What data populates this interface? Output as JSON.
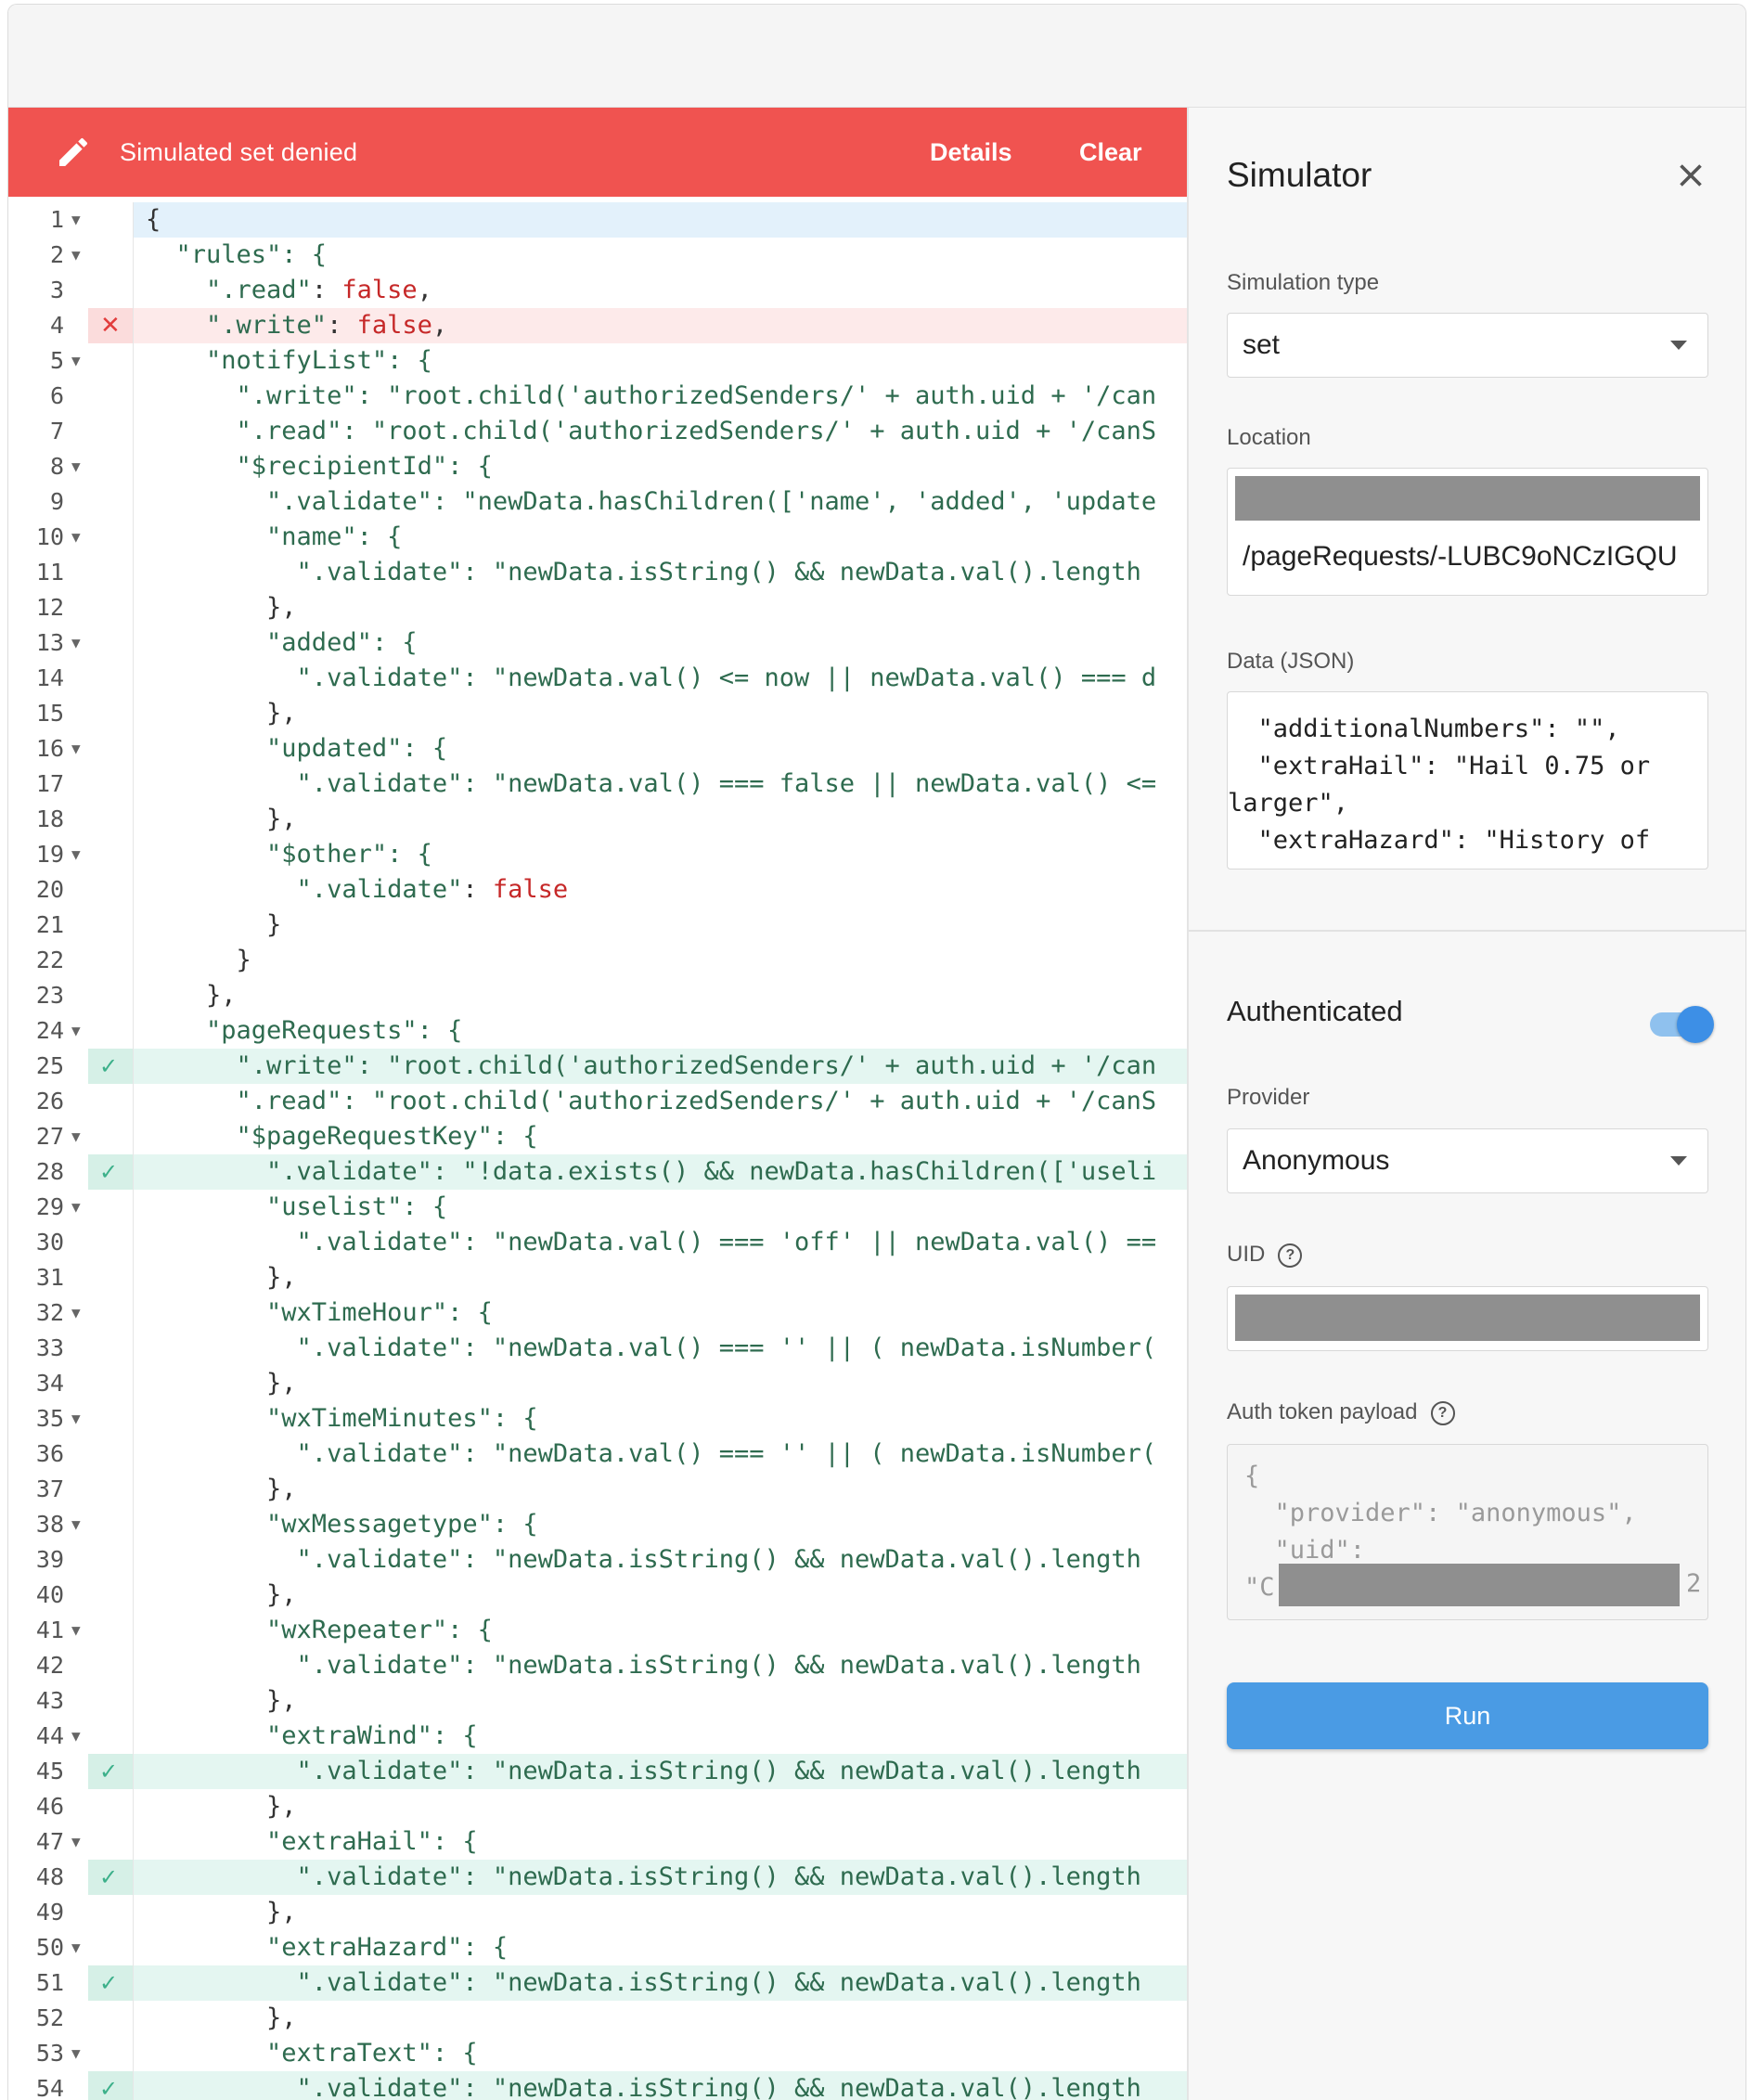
{
  "banner": {
    "message": "Simulated set denied",
    "details_label": "Details",
    "clear_label": "Clear",
    "color": "#f05350"
  },
  "editor": {
    "lines": [
      {
        "n": "1",
        "fold": true,
        "mark": "",
        "text": "{"
      },
      {
        "n": "2",
        "fold": true,
        "mark": "",
        "text": "  \"rules\": {"
      },
      {
        "n": "3",
        "fold": false,
        "mark": "",
        "text": "    \".read\": false,"
      },
      {
        "n": "4",
        "fold": false,
        "mark": "err",
        "text": "    \".write\": false,"
      },
      {
        "n": "5",
        "fold": true,
        "mark": "",
        "text": "    \"notifyList\": {"
      },
      {
        "n": "6",
        "fold": false,
        "mark": "",
        "text": "      \".write\": \"root.child('authorizedSenders/' + auth.uid + '/can"
      },
      {
        "n": "7",
        "fold": false,
        "mark": "",
        "text": "      \".read\": \"root.child('authorizedSenders/' + auth.uid + '/canS"
      },
      {
        "n": "8",
        "fold": true,
        "mark": "",
        "text": "      \"$recipientId\": {"
      },
      {
        "n": "9",
        "fold": false,
        "mark": "",
        "text": "        \".validate\": \"newData.hasChildren(['name', 'added', 'update"
      },
      {
        "n": "10",
        "fold": true,
        "mark": "",
        "text": "        \"name\": {"
      },
      {
        "n": "11",
        "fold": false,
        "mark": "",
        "text": "          \".validate\": \"newData.isString() && newData.val().length"
      },
      {
        "n": "12",
        "fold": false,
        "mark": "",
        "text": "        },"
      },
      {
        "n": "13",
        "fold": true,
        "mark": "",
        "text": "        \"added\": {"
      },
      {
        "n": "14",
        "fold": false,
        "mark": "",
        "text": "          \".validate\": \"newData.val() <= now || newData.val() === d"
      },
      {
        "n": "15",
        "fold": false,
        "mark": "",
        "text": "        },"
      },
      {
        "n": "16",
        "fold": true,
        "mark": "",
        "text": "        \"updated\": {"
      },
      {
        "n": "17",
        "fold": false,
        "mark": "",
        "text": "          \".validate\": \"newData.val() === false || newData.val() <="
      },
      {
        "n": "18",
        "fold": false,
        "mark": "",
        "text": "        },"
      },
      {
        "n": "19",
        "fold": true,
        "mark": "",
        "text": "        \"$other\": {"
      },
      {
        "n": "20",
        "fold": false,
        "mark": "",
        "text": "          \".validate\": false"
      },
      {
        "n": "21",
        "fold": false,
        "mark": "",
        "text": "        }"
      },
      {
        "n": "22",
        "fold": false,
        "mark": "",
        "text": "      }"
      },
      {
        "n": "23",
        "fold": false,
        "mark": "",
        "text": "    },"
      },
      {
        "n": "24",
        "fold": true,
        "mark": "",
        "text": "    \"pageRequests\": {"
      },
      {
        "n": "25",
        "fold": false,
        "mark": "ok",
        "text": "      \".write\": \"root.child('authorizedSenders/' + auth.uid + '/can"
      },
      {
        "n": "26",
        "fold": false,
        "mark": "",
        "text": "      \".read\": \"root.child('authorizedSenders/' + auth.uid + '/canS"
      },
      {
        "n": "27",
        "fold": true,
        "mark": "",
        "text": "      \"$pageRequestKey\": {"
      },
      {
        "n": "28",
        "fold": false,
        "mark": "ok",
        "text": "        \".validate\": \"!data.exists() && newData.hasChildren(['useli"
      },
      {
        "n": "29",
        "fold": true,
        "mark": "",
        "text": "        \"uselist\": {"
      },
      {
        "n": "30",
        "fold": false,
        "mark": "",
        "text": "          \".validate\": \"newData.val() === 'off' || newData.val() =="
      },
      {
        "n": "31",
        "fold": false,
        "mark": "",
        "text": "        },"
      },
      {
        "n": "32",
        "fold": true,
        "mark": "",
        "text": "        \"wxTimeHour\": {"
      },
      {
        "n": "33",
        "fold": false,
        "mark": "",
        "text": "          \".validate\": \"newData.val() === '' || ( newData.isNumber("
      },
      {
        "n": "34",
        "fold": false,
        "mark": "",
        "text": "        },"
      },
      {
        "n": "35",
        "fold": true,
        "mark": "",
        "text": "        \"wxTimeMinutes\": {"
      },
      {
        "n": "36",
        "fold": false,
        "mark": "",
        "text": "          \".validate\": \"newData.val() === '' || ( newData.isNumber("
      },
      {
        "n": "37",
        "fold": false,
        "mark": "",
        "text": "        },"
      },
      {
        "n": "38",
        "fold": true,
        "mark": "",
        "text": "        \"wxMessagetype\": {"
      },
      {
        "n": "39",
        "fold": false,
        "mark": "",
        "text": "          \".validate\": \"newData.isString() && newData.val().length"
      },
      {
        "n": "40",
        "fold": false,
        "mark": "",
        "text": "        },"
      },
      {
        "n": "41",
        "fold": true,
        "mark": "",
        "text": "        \"wxRepeater\": {"
      },
      {
        "n": "42",
        "fold": false,
        "mark": "",
        "text": "          \".validate\": \"newData.isString() && newData.val().length"
      },
      {
        "n": "43",
        "fold": false,
        "mark": "",
        "text": "        },"
      },
      {
        "n": "44",
        "fold": true,
        "mark": "",
        "text": "        \"extraWind\": {"
      },
      {
        "n": "45",
        "fold": false,
        "mark": "ok",
        "text": "          \".validate\": \"newData.isString() && newData.val().length"
      },
      {
        "n": "46",
        "fold": false,
        "mark": "",
        "text": "        },"
      },
      {
        "n": "47",
        "fold": true,
        "mark": "",
        "text": "        \"extraHail\": {"
      },
      {
        "n": "48",
        "fold": false,
        "mark": "ok",
        "text": "          \".validate\": \"newData.isString() && newData.val().length"
      },
      {
        "n": "49",
        "fold": false,
        "mark": "",
        "text": "        },"
      },
      {
        "n": "50",
        "fold": true,
        "mark": "",
        "text": "        \"extraHazard\": {"
      },
      {
        "n": "51",
        "fold": false,
        "mark": "ok",
        "text": "          \".validate\": \"newData.isString() && newData.val().length"
      },
      {
        "n": "52",
        "fold": false,
        "mark": "",
        "text": "        },"
      },
      {
        "n": "53",
        "fold": true,
        "mark": "",
        "text": "        \"extraText\": {"
      },
      {
        "n": "54",
        "fold": false,
        "mark": "ok",
        "text": "          \".validate\": \"newData.isString() && newData.val().length"
      }
    ]
  },
  "simulator": {
    "title": "Simulator",
    "simulation_type_label": "Simulation type",
    "simulation_type_value": "set",
    "location_label": "Location",
    "location_value": "/pageRequests/-LUBC9oNCzIGQU",
    "data_label": "Data (JSON)",
    "data_lines": [
      "  \"additionalNumbers\": \"\",",
      "  \"extraHail\": \"Hail 0.75 or",
      "larger\",",
      "  \"extraHazard\": \"History of"
    ],
    "authenticated_label": "Authenticated",
    "authenticated_on": true,
    "provider_label": "Provider",
    "provider_value": "Anonymous",
    "uid_label": "UID",
    "auth_token_label": "Auth token payload",
    "token_lines": [
      "{",
      "  \"provider\": \"anonymous\",",
      "  \"uid\":",
      "\"C"
    ],
    "token_tail": "2",
    "run_label": "Run",
    "run_color": "#4a9be4"
  }
}
